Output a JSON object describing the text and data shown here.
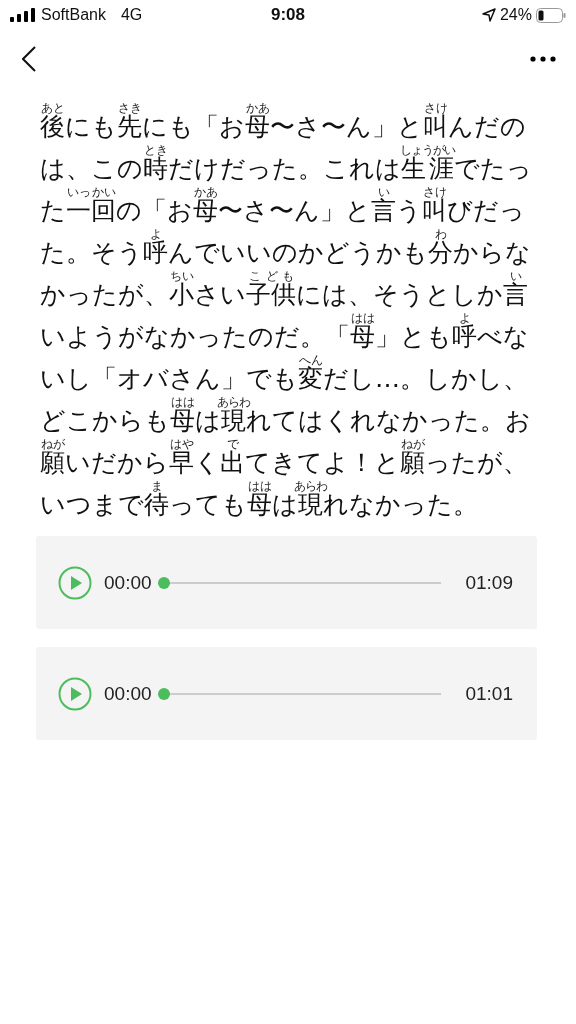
{
  "status_bar": {
    "carrier": "SoftBank",
    "network": "4G",
    "time": "9:08",
    "battery": "24%"
  },
  "passage": [
    {
      "text": "後",
      "ruby": "あと"
    },
    {
      "text": "にも"
    },
    {
      "text": "先",
      "ruby": "さき"
    },
    {
      "text": "にも「お"
    },
    {
      "text": "母",
      "ruby": "かあ"
    },
    {
      "text": "〜さ〜ん」と"
    },
    {
      "text": "叫",
      "ruby": "さけ"
    },
    {
      "text": "んだのは、この"
    },
    {
      "text": "時",
      "ruby": "とき"
    },
    {
      "text": "だけだった。これは"
    },
    {
      "text": "生涯",
      "ruby": "しょうがい"
    },
    {
      "text": "でたった"
    },
    {
      "text": "一回",
      "ruby": "いっかい"
    },
    {
      "text": "の「お"
    },
    {
      "text": "母",
      "ruby": "かあ"
    },
    {
      "text": "〜さ〜ん」と"
    },
    {
      "text": "言",
      "ruby": "い"
    },
    {
      "text": "う"
    },
    {
      "text": "叫",
      "ruby": "さけ"
    },
    {
      "text": "びだった。そう"
    },
    {
      "text": "呼",
      "ruby": "よ"
    },
    {
      "text": "んでいいのかどうかも"
    },
    {
      "text": "分",
      "ruby": "わ"
    },
    {
      "text": "からなかったが、"
    },
    {
      "text": "小",
      "ruby": "ちい"
    },
    {
      "text": "さい"
    },
    {
      "text": "子供",
      "ruby": "こども"
    },
    {
      "text": "には、そうとしか"
    },
    {
      "text": "言",
      "ruby": "い"
    },
    {
      "text": "いようがなかったのだ。「"
    },
    {
      "text": "母",
      "ruby": "はは"
    },
    {
      "text": "」とも"
    },
    {
      "text": "呼",
      "ruby": "よ"
    },
    {
      "text": "べないし「オバさん」でも"
    },
    {
      "text": "変",
      "ruby": "へん"
    },
    {
      "text": "だし…。しかし、どこからも"
    },
    {
      "text": "母",
      "ruby": "はは"
    },
    {
      "text": "は"
    },
    {
      "text": "現",
      "ruby": "あらわ"
    },
    {
      "text": "れてはくれなかった。お"
    },
    {
      "text": "願",
      "ruby": "ねが"
    },
    {
      "text": "いだから"
    },
    {
      "text": "早",
      "ruby": "はや"
    },
    {
      "text": "く"
    },
    {
      "text": "出",
      "ruby": "で"
    },
    {
      "text": "てきてよ！と"
    },
    {
      "text": "願",
      "ruby": "ねが"
    },
    {
      "text": "ったが、いつまで"
    },
    {
      "text": "待",
      "ruby": "ま"
    },
    {
      "text": "っても"
    },
    {
      "text": "母",
      "ruby": "はは"
    },
    {
      "text": "は"
    },
    {
      "text": "現",
      "ruby": "あらわ"
    },
    {
      "text": "れなかった。"
    }
  ],
  "players": [
    {
      "playing": false,
      "current": "00:00",
      "duration": "01:09",
      "level": 0
    },
    {
      "playing": false,
      "current": "00:00",
      "duration": "01:01",
      "level": 0
    }
  ]
}
